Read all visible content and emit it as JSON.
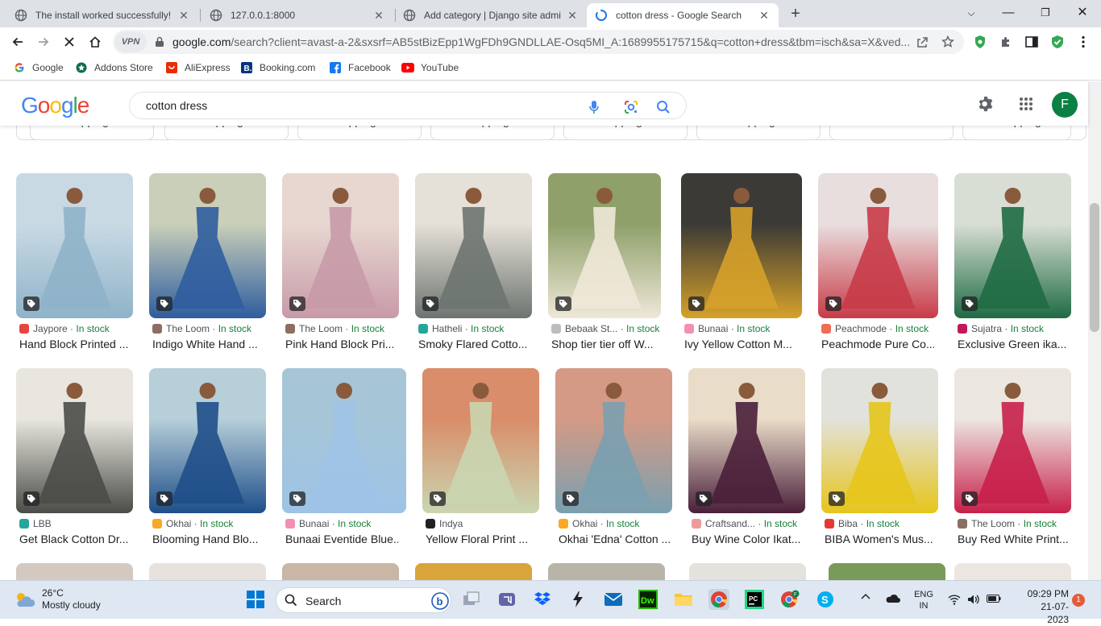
{
  "browser": {
    "tabs": [
      {
        "title": "The install worked successfully! C",
        "active": false
      },
      {
        "title": "127.0.0.1:8000",
        "active": false
      },
      {
        "title": "Add category | Django site admin",
        "active": false
      },
      {
        "title": "cotton dress - Google Search",
        "active": true
      }
    ],
    "url_host": "google.com",
    "url_path": "/search?client=avast-a-2&sxsrf=AB5stBizEpp1WgFDh9GNDLLAE-Osq5MI_A:1689955175715&q=cotton+dress&tbm=isch&sa=X&ved...",
    "vpn_label": "VPN",
    "bookmarks": [
      "Google",
      "Addons Store",
      "AliExpress",
      "Booking.com",
      "Facebook",
      "YouTube"
    ]
  },
  "google": {
    "logo": "Google",
    "query": "cotton dress",
    "avatar_letter": "F"
  },
  "chips": [
    "Free shipping",
    "Free shipping",
    "Free shipping",
    "Free shipping",
    "Free shipping",
    "Free shipping",
    "",
    "Free shipping"
  ],
  "results": {
    "row1": [
      {
        "source": "Jaypore",
        "stock": "In stock",
        "title": "Hand Block Printed ...",
        "icon_color": "#e8453c"
      },
      {
        "source": "The Loom",
        "stock": "In stock",
        "title": "Indigo White Hand ...",
        "icon_color": "#8d6e63"
      },
      {
        "source": "The Loom",
        "stock": "In stock",
        "title": "Pink Hand Block Pri...",
        "icon_color": "#8d6e63"
      },
      {
        "source": "Hatheli",
        "stock": "In stock",
        "title": "Smoky Flared Cotto...",
        "icon_color": "#26a69a"
      },
      {
        "source": "Bebaak St...",
        "stock": "In stock",
        "title": "Shop tier tier off W...",
        "icon_color": "#bdbdbd"
      },
      {
        "source": "Bunaai",
        "stock": "In stock",
        "title": "Ivy Yellow Cotton M...",
        "icon_color": "#f48fb1"
      },
      {
        "source": "Peachmode",
        "stock": "In stock",
        "title": "Peachmode Pure Co...",
        "icon_color": "#ef6c57"
      },
      {
        "source": "Sujatra",
        "stock": "In stock",
        "title": "Exclusive Green ika...",
        "icon_color": "#c2185b"
      }
    ],
    "row2": [
      {
        "source": "LBB",
        "stock": "",
        "title": "Get Black Cotton Dr...",
        "icon_color": "#26a69a"
      },
      {
        "source": "Okhai",
        "stock": "In stock",
        "title": "Blooming Hand Blo...",
        "icon_color": "#f9a825"
      },
      {
        "source": "Bunaai",
        "stock": "In stock",
        "title": "Bunaai Eventide Blue...",
        "icon_color": "#f48fb1"
      },
      {
        "source": "Indya",
        "stock": "",
        "title": "Yellow Floral Print ...",
        "icon_color": "#212121"
      },
      {
        "source": "Okhai",
        "stock": "In stock",
        "title": "Okhai 'Edna' Cotton ...",
        "icon_color": "#f9a825"
      },
      {
        "source": "Craftsand...",
        "stock": "In stock",
        "title": "Buy Wine Color Ikat...",
        "icon_color": "#ef9a9a"
      },
      {
        "source": "Biba",
        "stock": "In stock",
        "title": "BIBA Women's Mus...",
        "icon_color": "#e53935"
      },
      {
        "source": "The Loom",
        "stock": "In stock",
        "title": "Buy Red White Print...",
        "icon_color": "#8d6e63"
      }
    ]
  },
  "taskbar": {
    "temp": "26°C",
    "weather": "Mostly cloudy",
    "search_label": "Search",
    "lang_top": "ENG",
    "lang_bottom": "IN",
    "time": "09:29 PM",
    "date": "21-07-2023",
    "notifications": "1"
  }
}
